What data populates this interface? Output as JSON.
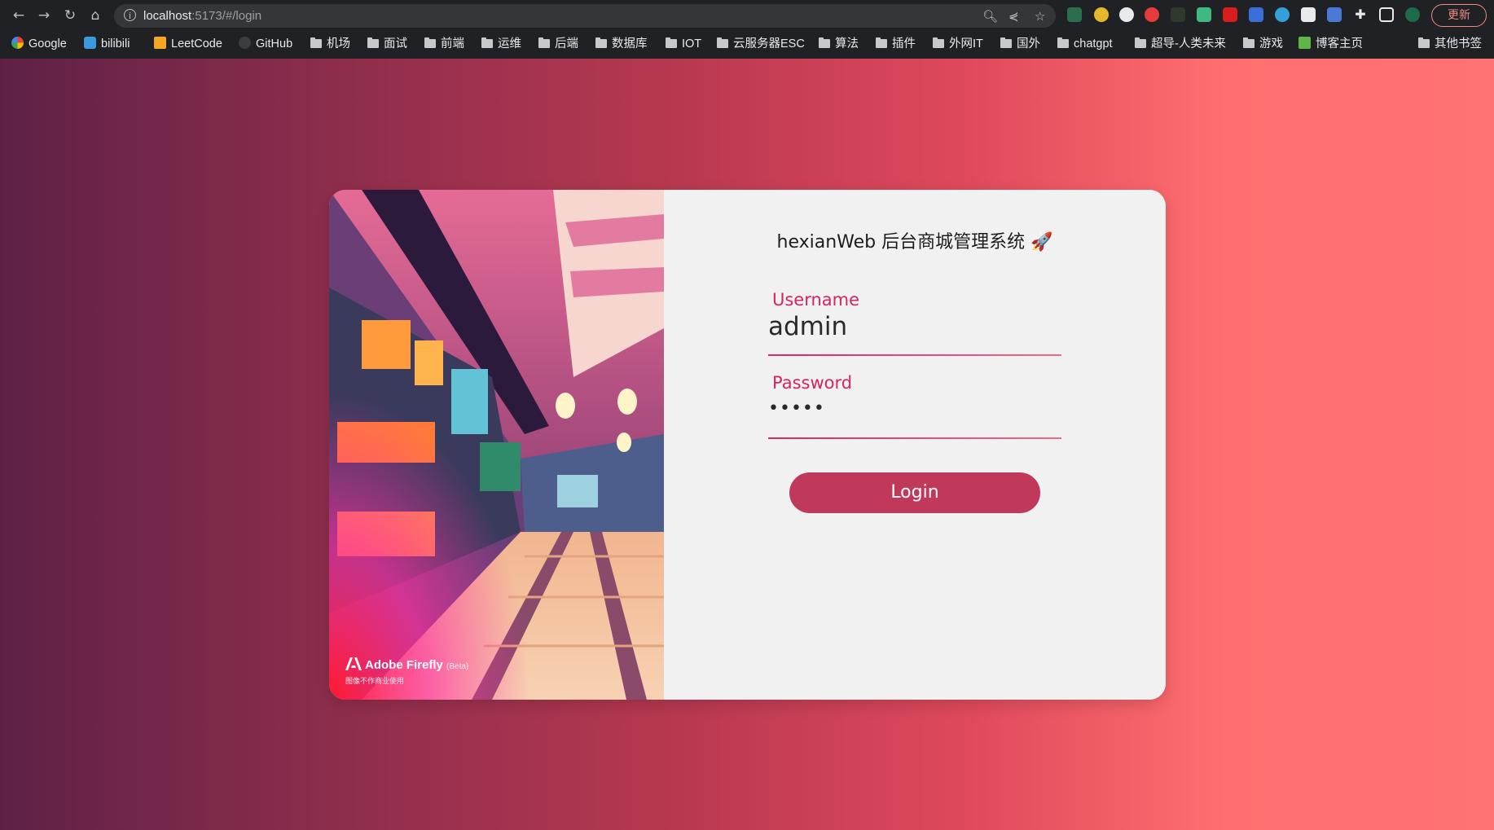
{
  "browser": {
    "url_host": "localhost",
    "url_path": ":5173/#/login",
    "update_label": "更新",
    "bookmarks": [
      {
        "label": "Google",
        "icon": "google-icon"
      },
      {
        "label": "bilibili",
        "icon": "bilibili-icon"
      },
      {
        "label": "LeetCode",
        "icon": "leetcode-icon"
      },
      {
        "label": "GitHub",
        "icon": "github-icon"
      },
      {
        "label": "机场",
        "icon": "folder-icon"
      },
      {
        "label": "面试",
        "icon": "folder-icon"
      },
      {
        "label": "前端",
        "icon": "folder-icon"
      },
      {
        "label": "运维",
        "icon": "folder-icon"
      },
      {
        "label": "后端",
        "icon": "folder-icon"
      },
      {
        "label": "数据库",
        "icon": "folder-icon"
      },
      {
        "label": "IOT",
        "icon": "folder-icon"
      },
      {
        "label": "云服务器ESC",
        "icon": "folder-icon"
      },
      {
        "label": "算法",
        "icon": "folder-icon"
      },
      {
        "label": "插件",
        "icon": "folder-icon"
      },
      {
        "label": "外网IT",
        "icon": "folder-icon"
      },
      {
        "label": "国外",
        "icon": "folder-icon"
      },
      {
        "label": "chatgpt",
        "icon": "folder-icon"
      },
      {
        "label": "超导-人类未来",
        "icon": "folder-icon"
      },
      {
        "label": "游戏",
        "icon": "folder-icon"
      },
      {
        "label": "博客主页",
        "icon": "blog-icon"
      },
      {
        "label": "其他书签",
        "icon": "folder-icon"
      }
    ]
  },
  "login": {
    "title": "hexianWeb 后台商城管理系统 🚀",
    "username_label": "Username",
    "username_value": "admin",
    "password_label": "Password",
    "password_value": "•••••",
    "button_label": "Login"
  },
  "hero": {
    "brand": "Adobe Firefly",
    "brand_tag": "(Beta)",
    "notice": "图像不作商业使用"
  },
  "colors": {
    "accent": "#d6245f",
    "button": "#c0395a",
    "panel_bg": "#f1f1f1",
    "bg_start": "#5e2146",
    "bg_end": "#ff7372"
  }
}
